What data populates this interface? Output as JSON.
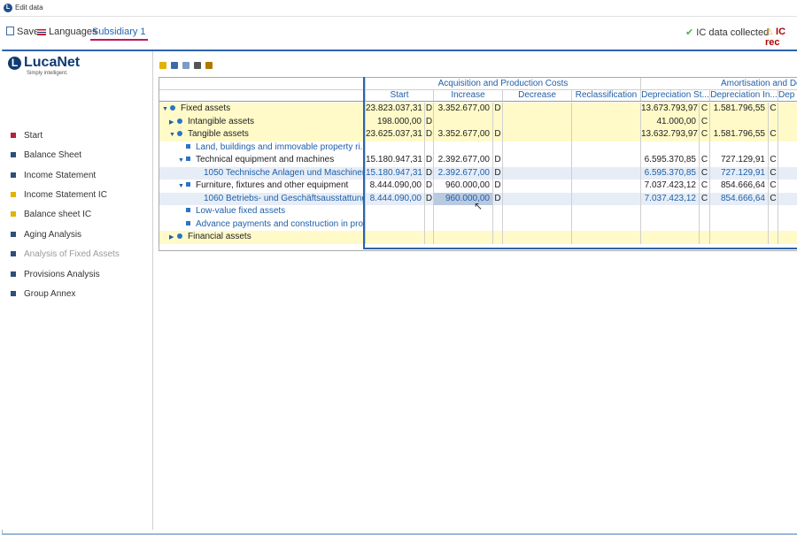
{
  "window": {
    "title": "Edit data"
  },
  "toolbar": {
    "save": "Save",
    "languages": "Languages",
    "active_tab": "Subsidiary 1",
    "ic_collected": "IC data collected",
    "ic_rec": "IC rec"
  },
  "logo": {
    "name": "LucaNet",
    "tagline": "Simply intelligent."
  },
  "nav": [
    {
      "label": "Start",
      "color": "#b0243a"
    },
    {
      "label": "Balance Sheet",
      "color": "#2c4f7c"
    },
    {
      "label": "Income Statement",
      "color": "#2c4f7c"
    },
    {
      "label": "Income Statement IC",
      "color": "#e0b400"
    },
    {
      "label": "Balance sheet IC",
      "color": "#e0b400"
    },
    {
      "label": "Aging Analysis",
      "color": "#2c4f7c"
    },
    {
      "label": "Analysis of Fixed Assets",
      "color": "#2c4f7c"
    },
    {
      "label": "Provisions Analysis",
      "color": "#2c4f7c"
    },
    {
      "label": "Group Annex",
      "color": "#2c4f7c"
    }
  ],
  "grid": {
    "group_headers": {
      "apc": "Acquisition and Production Costs",
      "amort": "Amortisation and De"
    },
    "columns": {
      "start": "Start",
      "increase": "Increase",
      "decrease": "Decrease",
      "reclass": "Reclassification",
      "dep_start": "Depreciation St...",
      "dep_inc": "Depreciation In...",
      "dep_more": "Dep"
    },
    "rows": [
      {
        "label": "Fixed assets",
        "start": "23.823.037,31",
        "sd": "D",
        "inc": "3.352.677,00",
        "id": "D",
        "dep_start": "13.673.793,97",
        "dsd": "C",
        "dep_inc": "1.581.796,55",
        "did": "C"
      },
      {
        "label": "Intangible assets",
        "start": "198.000,00",
        "sd": "D",
        "inc": "",
        "id": "",
        "dep_start": "41.000,00",
        "dsd": "C",
        "dep_inc": "",
        "did": ""
      },
      {
        "label": "Tangible assets",
        "start": "23.625.037,31",
        "sd": "D",
        "inc": "3.352.677,00",
        "id": "D",
        "dep_start": "13.632.793,97",
        "dsd": "C",
        "dep_inc": "1.581.796,55",
        "did": "C"
      },
      {
        "label": "Land, buildings and immovable property ri...",
        "start": "",
        "sd": "",
        "inc": "",
        "id": "",
        "dep_start": "",
        "dsd": "",
        "dep_inc": "",
        "did": ""
      },
      {
        "label": "Technical equipment and machines",
        "start": "15.180.947,31",
        "sd": "D",
        "inc": "2.392.677,00",
        "id": "D",
        "dep_start": "6.595.370,85",
        "dsd": "C",
        "dep_inc": "727.129,91",
        "did": "C"
      },
      {
        "label": "1050 Technische Anlagen und Maschinen",
        "start": "15.180.947,31",
        "sd": "D",
        "inc": "2.392.677,00",
        "id": "D",
        "dep_start": "6.595.370,85",
        "dsd": "C",
        "dep_inc": "727.129,91",
        "did": "C"
      },
      {
        "label": "Furniture, fixtures and other equipment",
        "start": "8.444.090,00",
        "sd": "D",
        "inc": "960.000,00",
        "id": "D",
        "dep_start": "7.037.423,12",
        "dsd": "C",
        "dep_inc": "854.666,64",
        "did": "C"
      },
      {
        "label": "1060 Betriebs- und Geschäftsausstattung",
        "start": "8.444.090,00",
        "sd": "D",
        "inc": "960.000,00",
        "id": "D",
        "dep_start": "7.037.423,12",
        "dsd": "C",
        "dep_inc": "854.666,64",
        "did": "C"
      },
      {
        "label": "Low-value fixed assets",
        "start": "",
        "sd": "",
        "inc": "",
        "id": "",
        "dep_start": "",
        "dsd": "",
        "dep_inc": "",
        "did": ""
      },
      {
        "label": "Advance payments and construction in pro...",
        "start": "",
        "sd": "",
        "inc": "",
        "id": "",
        "dep_start": "",
        "dsd": "",
        "dep_inc": "",
        "did": ""
      },
      {
        "label": "Financial assets",
        "start": "",
        "sd": "",
        "inc": "",
        "id": "",
        "dep_start": "",
        "dsd": "",
        "dep_inc": "",
        "did": ""
      }
    ]
  }
}
